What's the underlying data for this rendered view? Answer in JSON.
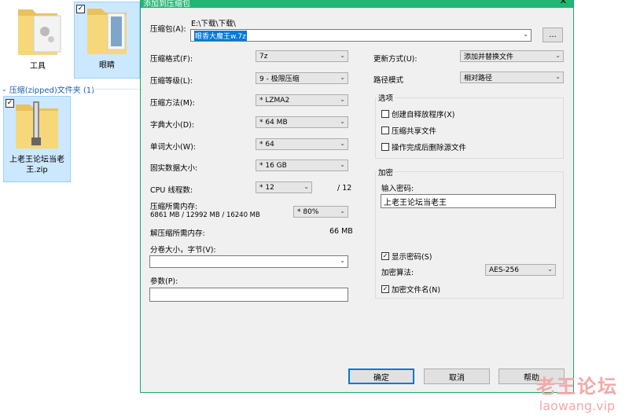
{
  "explorer": {
    "folders": [
      {
        "label": "工具"
      },
      {
        "label": "眼睛"
      }
    ],
    "group_header": "压缩(zipped)文件夹 (1)",
    "zip_item": {
      "label_line1": "上老王论坛当老",
      "label_line2": "王.zip"
    },
    "check_mark": "✓"
  },
  "dialog": {
    "title": "添加到压缩包",
    "close": "✕",
    "archive_label": "压缩包(A):",
    "archive_path": "E:\\下载\\下载\\",
    "archive_name": "眼香大魔王w.7z",
    "browse": "...",
    "left": {
      "format_label": "压缩格式(F):",
      "format_value": "7z",
      "level_label": "压缩等级(L):",
      "level_value": "9 - 极限压缩",
      "method_label": "压缩方法(M):",
      "method_value": "* LZMA2",
      "dict_label": "字典大小(D):",
      "dict_value": "* 64 MB",
      "word_label": "单词大小(W):",
      "word_value": "* 64",
      "solid_label": "固实数据大小:",
      "solid_value": "* 16 GB",
      "cpu_label": "CPU 线程数:",
      "cpu_value": "* 12",
      "cpu_total": "/ 12",
      "mem_label": "压缩所需内存:",
      "mem_detail": "6861 MB / 12992 MB / 16240 MB",
      "mem_value": "* 80%",
      "decomp_label": "解压缩所需内存:",
      "decomp_value": "66 MB",
      "split_label": "分卷大小，字节(V):",
      "split_value": "",
      "params_label": "参数(P):",
      "params_value": ""
    },
    "right": {
      "update_label": "更新方式(U):",
      "update_value": "添加并替换文件",
      "path_label": "路径模式",
      "path_value": "相对路径",
      "options_title": "选项",
      "opt_sfx": "创建自释放程序(X)",
      "opt_shared": "压缩共享文件",
      "opt_delete": "操作完成后删除源文件",
      "enc_title": "加密",
      "pwd_label": "输入密码:",
      "pwd_value": "上老王论坛当老王",
      "show_pwd": "显示密码(S)",
      "algo_label": "加密算法:",
      "algo_value": "AES-256",
      "enc_names": "加密文件名(N)"
    },
    "buttons": {
      "ok": "确定",
      "cancel": "取消",
      "help": "帮助"
    },
    "check_mark": "✓",
    "arrow": "⌄"
  },
  "watermark": {
    "cn": "老王论坛",
    "en": "laowang.vip"
  }
}
